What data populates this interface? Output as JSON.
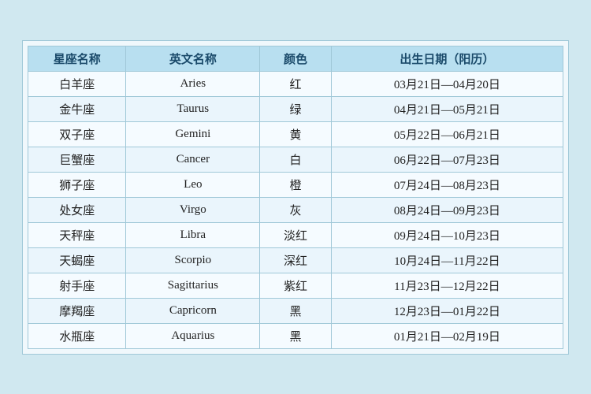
{
  "header": {
    "col1": "星座名称",
    "col2": "英文名称",
    "col3": "颜色",
    "col4": "出生日期（阳历）"
  },
  "rows": [
    {
      "chinese": "白羊座",
      "english": "Aries",
      "color": "红",
      "date": "03月21日—04月20日"
    },
    {
      "chinese": "金牛座",
      "english": "Taurus",
      "color": "绿",
      "date": "04月21日—05月21日"
    },
    {
      "chinese": "双子座",
      "english": "Gemini",
      "color": "黄",
      "date": "05月22日—06月21日"
    },
    {
      "chinese": "巨蟹座",
      "english": "Cancer",
      "color": "白",
      "date": "06月22日—07月23日"
    },
    {
      "chinese": "狮子座",
      "english": "Leo",
      "color": "橙",
      "date": "07月24日—08月23日"
    },
    {
      "chinese": "处女座",
      "english": "Virgo",
      "color": "灰",
      "date": "08月24日—09月23日"
    },
    {
      "chinese": "天秤座",
      "english": "Libra",
      "color": "淡红",
      "date": "09月24日—10月23日"
    },
    {
      "chinese": "天蝎座",
      "english": "Scorpio",
      "color": "深红",
      "date": "10月24日—11月22日"
    },
    {
      "chinese": "射手座",
      "english": "Sagittarius",
      "color": "紫红",
      "date": "11月23日—12月22日"
    },
    {
      "chinese": "摩羯座",
      "english": "Capricorn",
      "color": "黑",
      "date": "12月23日—01月22日"
    },
    {
      "chinese": "水瓶座",
      "english": "Aquarius",
      "color": "黑",
      "date": "01月21日—02月19日"
    }
  ]
}
